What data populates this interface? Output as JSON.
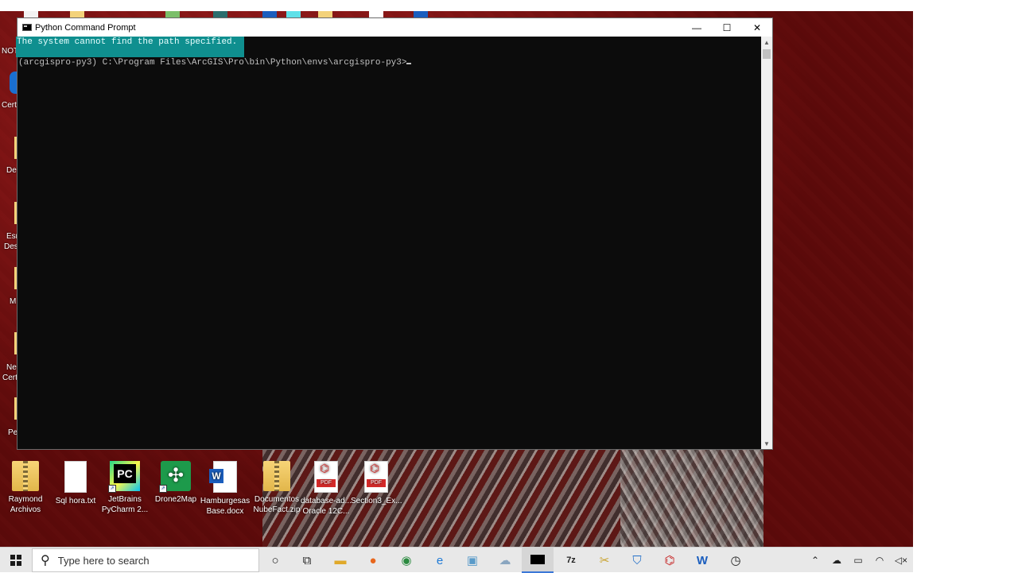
{
  "window": {
    "title": "Python Command Prompt",
    "controls": {
      "minimize": "—",
      "maximize": "☐",
      "close": "✕"
    }
  },
  "console": {
    "error_line": "The system cannot find the path specified.",
    "prompt_line": "(arcgispro-py3) C:\\Program Files\\ArcGIS\\Pro\\bin\\Python\\envs\\arcgispro-py3>"
  },
  "desktop": {
    "left_labels": [
      "NOT",
      "Cert",
      "De",
      "Esr",
      "Des",
      "M",
      "Ne",
      "Cert",
      "Pe"
    ],
    "icons": [
      {
        "label1": "Raymond",
        "label2": "Archivos",
        "icon": "zip-folder-icon"
      },
      {
        "label1": "Sql hora.txt",
        "label2": "",
        "icon": "text-file-icon"
      },
      {
        "label1": "JetBrains",
        "label2": "PyCharm 2...",
        "icon": "pycharm-icon"
      },
      {
        "label1": "Drone2Map",
        "label2": "",
        "icon": "drone2map-icon"
      },
      {
        "label1": "Hamburgesas",
        "label2": "Base.docx",
        "icon": "word-document-icon"
      },
      {
        "label1": "Documentos",
        "label2": "NubeFact.zip",
        "icon": "zip-folder-icon"
      },
      {
        "label1": "database-ad...",
        "label2": "Oracle 12C...",
        "icon": "pdf-icon"
      },
      {
        "label1": "Section3_Ex...",
        "label2": "",
        "icon": "pdf-icon"
      }
    ]
  },
  "taskbar": {
    "search_placeholder": "Type here to search",
    "apps": [
      "cortana-icon",
      "task-view-icon",
      "file-explorer-icon",
      "firefox-icon",
      "chrome-icon",
      "edge-icon",
      "photos-icon",
      "cloud-app-icon",
      "command-prompt-icon",
      "7zip-icon",
      "tools-icon",
      "shield-app-icon",
      "acrobat-icon",
      "word-icon",
      "clock-app-icon"
    ],
    "tray": [
      "chevron-up-icon",
      "onedrive-offline-icon",
      "battery-icon",
      "wifi-icon",
      "volume-muted-icon"
    ]
  },
  "colors": {
    "console_bg": "#0c0c0c",
    "console_text": "#c0c0c0",
    "error_highlight": "#0f8f8f",
    "wallpaper": "#8a1a1a"
  }
}
